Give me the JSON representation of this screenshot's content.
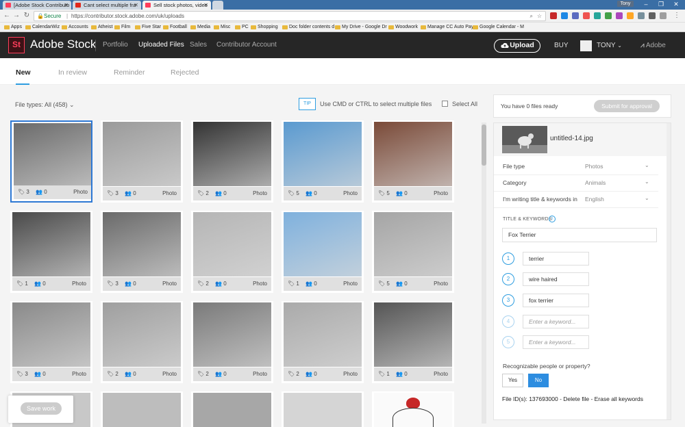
{
  "browser": {
    "tabs": [
      {
        "label": "[Adobe Stock Contributo",
        "color": "#ff3e5b"
      },
      {
        "label": "Cant select multiple fra",
        "color": "#e0281b"
      },
      {
        "label": "Sell stock photos, video",
        "color": "#ff3e5b"
      }
    ],
    "user": "Tony",
    "secure": "Secure",
    "url": "https://contributor.stock.adobe.com/uk/uploads",
    "bookmarks": [
      "Apps",
      "CalendarWiz",
      "Accounts",
      "Atheist",
      "Film",
      "Five Star",
      "Football",
      "Media",
      "Misc",
      "PC",
      "Shopping",
      "Doc folder contents d",
      "My Drive - Google Dr",
      "Woodwork",
      "Manage CC Auto Pay",
      "Google Calendar - M"
    ]
  },
  "header": {
    "logo": "St",
    "brand": "Adobe Stock",
    "nav": [
      "Portfolio",
      "Uploaded Files",
      "Sales",
      "Contributor Account"
    ],
    "upload": "Upload",
    "buy": "BUY",
    "user": "TONY",
    "adobe": "Adobe"
  },
  "subtabs": [
    "New",
    "In review",
    "Reminder",
    "Rejected"
  ],
  "toolbar": {
    "file_types": "File types: All (458)",
    "tip": "TIP",
    "tip_text": "Use CMD or CTRL to select multiple files",
    "select_all": "Select All"
  },
  "grid": [
    {
      "tags": "3",
      "people": "0",
      "kind": "Photo",
      "tone": "#6b6b6b"
    },
    {
      "tags": "3",
      "people": "0",
      "kind": "Photo",
      "tone": "#9a9a9a"
    },
    {
      "tags": "2",
      "people": "0",
      "kind": "Photo",
      "tone": "#333333"
    },
    {
      "tags": "5",
      "people": "0",
      "kind": "Photo",
      "tone": "#5a9ad0"
    },
    {
      "tags": "5",
      "people": "0",
      "kind": "Photo",
      "tone": "#7a4a38"
    },
    {
      "tags": "1",
      "people": "0",
      "kind": "Photo",
      "tone": "#4a4a4a"
    },
    {
      "tags": "3",
      "people": "0",
      "kind": "Photo",
      "tone": "#6a6a6a"
    },
    {
      "tags": "2",
      "people": "0",
      "kind": "Photo",
      "tone": "#b5b5b5"
    },
    {
      "tags": "1",
      "people": "0",
      "kind": "Photo",
      "tone": "#7fb1dd"
    },
    {
      "tags": "5",
      "people": "0",
      "kind": "Photo",
      "tone": "#a5a5a5"
    },
    {
      "tags": "3",
      "people": "0",
      "kind": "Photo",
      "tone": "#8a8a8a"
    },
    {
      "tags": "2",
      "people": "0",
      "kind": "Photo",
      "tone": "#9f9f9f"
    },
    {
      "tags": "2",
      "people": "0",
      "kind": "Photo",
      "tone": "#7a7a7a"
    },
    {
      "tags": "2",
      "people": "0",
      "kind": "Photo",
      "tone": "#aaaaaa"
    },
    {
      "tags": "1",
      "people": "0",
      "kind": "Photo",
      "tone": "#555555"
    }
  ],
  "save_work": "Save work",
  "panel": {
    "files_count": "You have 0 files ready",
    "submit": "Submit for approval",
    "filename": "untitled-14.jpg",
    "rows": [
      {
        "label": "File type",
        "value": "Photos"
      },
      {
        "label": "Category",
        "value": "Animals"
      },
      {
        "label": "I'm writing title & keywords in",
        "value": "English"
      }
    ],
    "tk_label": "TITLE & KEYWORDS",
    "title_value": "Fox Terrier",
    "keywords": [
      {
        "num": "1",
        "value": "terrier"
      },
      {
        "num": "2",
        "value": "wire haired"
      },
      {
        "num": "3",
        "value": "fox terrier"
      }
    ],
    "empty_keywords": [
      {
        "num": "4",
        "placeholder": "Enter a keyword..."
      },
      {
        "num": "5",
        "placeholder": "Enter a keyword..."
      }
    ],
    "recognizable": "Recognizable people or property?",
    "yes": "Yes",
    "no": "No",
    "file_id": "File ID(s): 137693000 - Delete file - Erase all keywords"
  }
}
